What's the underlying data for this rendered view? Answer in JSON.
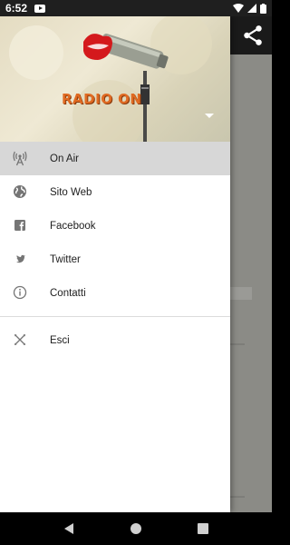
{
  "status_bar": {
    "time": "6:52"
  },
  "header": {
    "brand": "RADIO ON"
  },
  "menu": {
    "items": [
      {
        "label": "On Air",
        "icon": "radio-tower-icon",
        "active": true
      },
      {
        "label": "Sito Web",
        "icon": "globe-icon"
      },
      {
        "label": "Facebook",
        "icon": "facebook-icon"
      },
      {
        "label": "Twitter",
        "icon": "twitter-icon"
      },
      {
        "label": "Contatti",
        "icon": "info-icon"
      }
    ],
    "exit": {
      "label": "Esci",
      "icon": "close-x-icon"
    }
  },
  "colors": {
    "brand_orange": "#e06a22",
    "active_bg": "#d7d7d7",
    "icon_grey": "#757575"
  }
}
